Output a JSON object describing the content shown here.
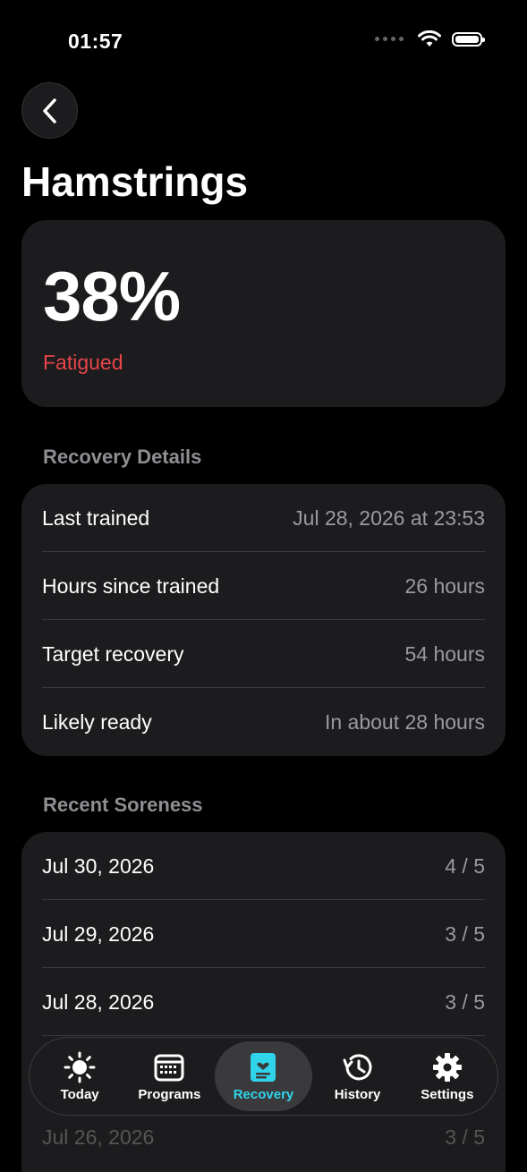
{
  "status": {
    "time": "01:57"
  },
  "page": {
    "title": "Hamstrings"
  },
  "score": {
    "value": "38%",
    "status": "Fatigued",
    "status_color": "#e8454b"
  },
  "recovery_details": {
    "header": "Recovery Details",
    "rows": [
      {
        "label": "Last trained",
        "value": "Jul 28, 2026 at 23:53"
      },
      {
        "label": "Hours since trained",
        "value": "26 hours"
      },
      {
        "label": "Target recovery",
        "value": "54 hours"
      },
      {
        "label": "Likely ready",
        "value": "In about 28 hours"
      }
    ]
  },
  "recent_soreness": {
    "header": "Recent Soreness",
    "rows": [
      {
        "label": "Jul 30, 2026",
        "value": "4 / 5"
      },
      {
        "label": "Jul 29, 2026",
        "value": "3 / 5"
      },
      {
        "label": "Jul 28, 2026",
        "value": "3 / 5"
      },
      {
        "label": "Jul 26, 2026",
        "value": "3 / 5"
      }
    ]
  },
  "tabs": [
    {
      "label": "Today",
      "icon": "sun-icon"
    },
    {
      "label": "Programs",
      "icon": "calendar-icon"
    },
    {
      "label": "Recovery",
      "icon": "recovery-icon",
      "active": true
    },
    {
      "label": "History",
      "icon": "history-icon"
    },
    {
      "label": "Settings",
      "icon": "gear-icon"
    }
  ],
  "colors": {
    "accent": "#2fd4ea",
    "card": "#1c1c1e",
    "background": "#000000"
  }
}
